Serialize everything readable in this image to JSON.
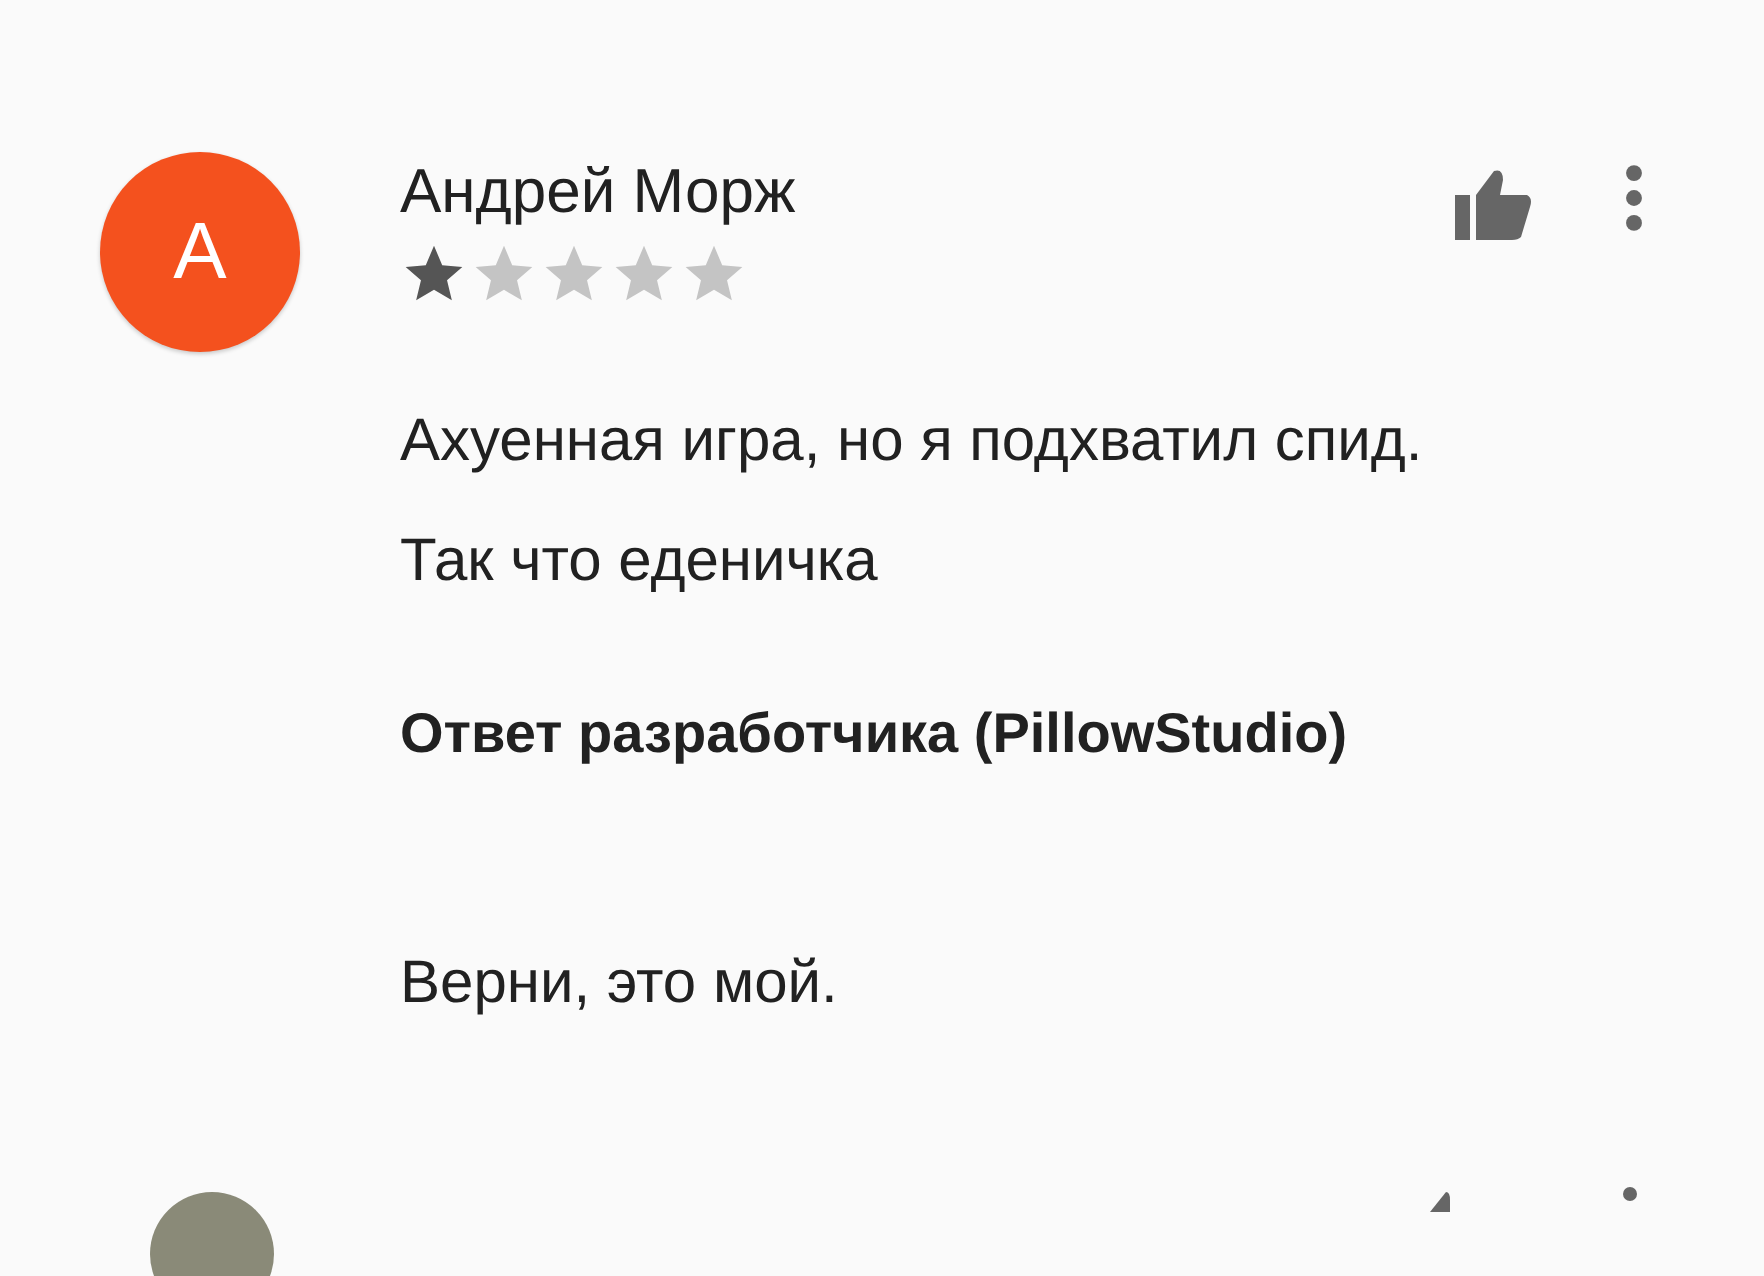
{
  "review": {
    "avatar_letter": "А",
    "author": "Андрей Морж",
    "stars": 1,
    "text": "Ахуенная игра, но я подхватил спид. Так что еденичка",
    "developer_reply": {
      "heading": "Ответ разработчика (PillowStudio)",
      "text": "Верни, это мой."
    }
  },
  "next_review": {
    "kind": "partial"
  }
}
